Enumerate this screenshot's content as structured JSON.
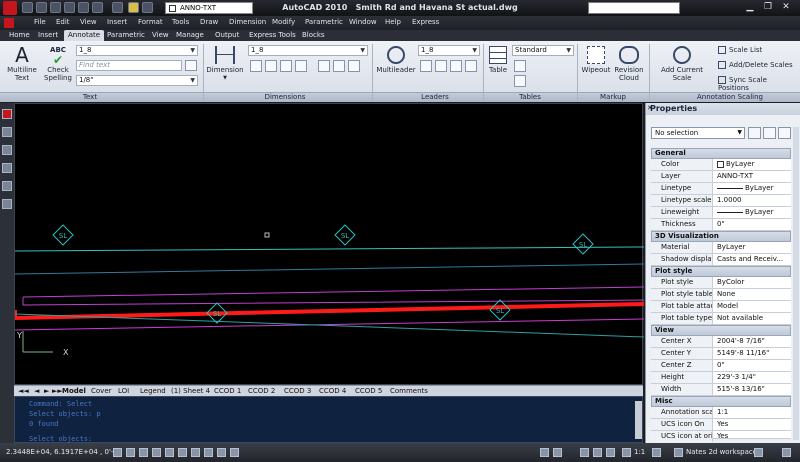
{
  "window": {
    "app": "AutoCAD 2010",
    "file": "Smith Rd and Havana St actual.dwg",
    "layer_dropdown": "ANNO-TXT"
  },
  "menu": [
    "File",
    "Edit",
    "View",
    "Insert",
    "Format",
    "Tools",
    "Draw",
    "Dimension",
    "Modify",
    "Parametric",
    "Window",
    "Help",
    "Express"
  ],
  "tabs": [
    "Home",
    "Insert",
    "Annotate",
    "Parametric",
    "View",
    "Manage",
    "Output",
    "Express Tools",
    "Blocks"
  ],
  "active_tab": "Annotate",
  "ribbon": {
    "text": {
      "multiline": "Multiline\nText",
      "check": "Check\nSpelling",
      "abc": "ABC",
      "style": "1_8",
      "find_placeholder": "Find text",
      "height": "1/8\"",
      "label": "Text"
    },
    "dimensions": {
      "button": "Dimension",
      "style": "1_8",
      "label": "Dimensions"
    },
    "leaders": {
      "button": "Multileader",
      "style": "1_8",
      "label": "Leaders"
    },
    "tables": {
      "button": "Table",
      "style": "Standard",
      "label": "Tables"
    },
    "markup": {
      "wipeout": "Wipeout",
      "revision": "Revision\nCloud",
      "label": "Markup"
    },
    "scaling": {
      "add": "Add Current Scale",
      "list": "Scale List",
      "add_delete": "Add/Delete Scales",
      "sync": "Sync Scale Positions",
      "label": "Annotation Scaling"
    }
  },
  "drawing": {
    "markers": [
      "SL",
      "SL",
      "SL",
      "SL",
      "SL"
    ],
    "axis_x": "X",
    "axis_y": "Y"
  },
  "layout_tabs": [
    "Model",
    "Cover",
    "LOI",
    "Legend",
    "(1) Sheet 4",
    "CCOD 1",
    "CCOD 2",
    "CCOD 3",
    "CCOD 4",
    "CCOD 5",
    "Comments"
  ],
  "command_lines": [
    "Command: Select",
    "Select objects: p",
    "0 found",
    "",
    "Select objects:"
  ],
  "status": {
    "coords": "2.3448E+04,  6.1917E+04 , 0'-0\"",
    "scale": "1:1",
    "workspace": "Nates 2d workspace"
  },
  "properties": {
    "title": "Properties",
    "selection": "No selection",
    "sections": [
      {
        "name": "General",
        "rows": [
          [
            "Color",
            "ByLayer"
          ],
          [
            "Layer",
            "ANNO-TXT"
          ],
          [
            "Linetype",
            "ByLayer"
          ],
          [
            "Linetype scale",
            "1.0000"
          ],
          [
            "Lineweight",
            "ByLayer"
          ],
          [
            "Thickness",
            "0\""
          ]
        ]
      },
      {
        "name": "3D Visualization",
        "rows": [
          [
            "Material",
            "ByLayer"
          ],
          [
            "Shadow display",
            "Casts and Receiv..."
          ]
        ]
      },
      {
        "name": "Plot style",
        "rows": [
          [
            "Plot style",
            "ByColor"
          ],
          [
            "Plot style table",
            "None"
          ],
          [
            "Plot table attach...",
            "Model"
          ],
          [
            "Plot table type",
            "Not available"
          ]
        ]
      },
      {
        "name": "View",
        "rows": [
          [
            "Center X",
            "2004'-8 7/16\""
          ],
          [
            "Center Y",
            "5149'-8 11/16\""
          ],
          [
            "Center Z",
            "0\""
          ],
          [
            "Height",
            "229'-3 1/4\""
          ],
          [
            "Width",
            "515'-8 13/16\""
          ]
        ]
      },
      {
        "name": "Misc",
        "rows": [
          [
            "Annotation scale",
            "1:1"
          ],
          [
            "UCS icon On",
            "Yes"
          ],
          [
            "UCS icon at origin",
            "Yes"
          ]
        ]
      }
    ]
  },
  "colors": {
    "red_line": "#ff1a1a",
    "teal_line": "#35c0c0",
    "magenta_line": "#c040d0",
    "marker": "#2fbfbf"
  }
}
